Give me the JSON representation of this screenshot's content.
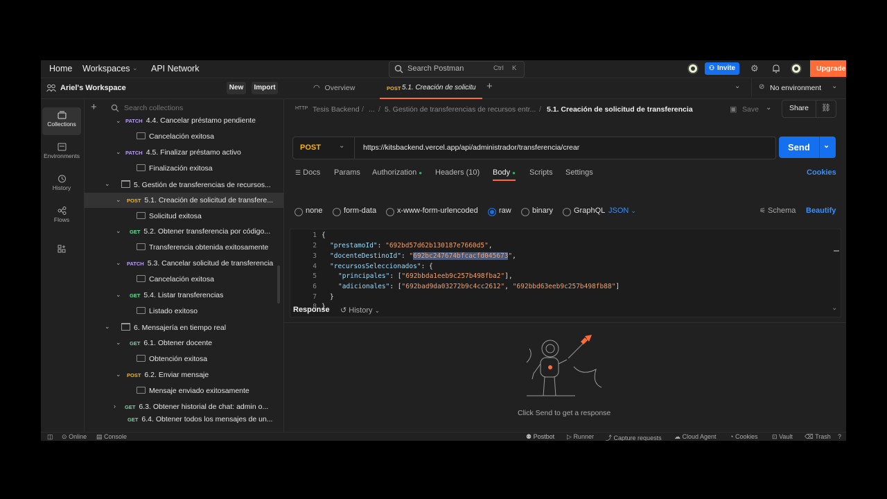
{
  "topbar": {
    "home": "Home",
    "workspaces": "Workspaces",
    "api_network": "API Network",
    "search_placeholder": "Search Postman",
    "shortcut_ctrl": "Ctrl",
    "shortcut_k": "K",
    "invite": "Invite",
    "upgrade": "Upgrade"
  },
  "workspace": {
    "name": "Ariel's Workspace",
    "new": "New",
    "import": "Import",
    "search_placeholder": "Search collections"
  },
  "rail": {
    "collections": "Collections",
    "environments": "Environments",
    "history": "History",
    "flows": "Flows"
  },
  "tree": [
    {
      "method": "PATCH",
      "label": "4.4. Cancelar préstamo pendiente"
    },
    {
      "label": "Cancelación exitosa"
    },
    {
      "method": "PATCH",
      "label": "4.5. Finalizar préstamo activo"
    },
    {
      "label": "Finalización exitosa"
    },
    {
      "label": "5. Gestión de transferencias de recursos..."
    },
    {
      "method": "POST",
      "label": "5.1. Creación de solicitud de transfere..."
    },
    {
      "label": "Solicitud exitosa"
    },
    {
      "method": "GET",
      "label": "5.2. Obtener transferencia por código..."
    },
    {
      "label": "Transferencia obtenida exitosamente"
    },
    {
      "method": "PATCH",
      "label": "5.3. Cancelar solicitud de transferencia"
    },
    {
      "label": "Cancelación exitosa"
    },
    {
      "method": "GET",
      "label": "5.4. Listar transferencias"
    },
    {
      "label": "Listado exitoso"
    },
    {
      "label": "6. Mensajería en tiempo real"
    },
    {
      "method": "GET",
      "label": "6.1. Obtener docente"
    },
    {
      "label": "Obtención exitosa"
    },
    {
      "method": "POST",
      "label": "6.2. Enviar mensaje"
    },
    {
      "label": "Mensaje enviado exitosamente"
    },
    {
      "method": "GET",
      "label": "6.3. Obtener historial de chat: admin o..."
    },
    {
      "method": "GET",
      "label": "6.4. Obtener todos los mensajes de un..."
    }
  ],
  "tabs": {
    "overview": "Overview",
    "active_method": "POST",
    "active_label": "5.1. Creación de solicitu",
    "environment": "No environment"
  },
  "breadcrumb": {
    "root": "Tesis Backend",
    "ellipsis": "...",
    "folder": "5. Gestión de transferencias de recursos entr...",
    "current": "5.1. Creación de solicitud de transferencia",
    "save": "Save",
    "share": "Share"
  },
  "request": {
    "method": "POST",
    "url": "https://kitsbackend.vercel.app/api/administrador/transferencia/crear",
    "send": "Send"
  },
  "subtabs": {
    "docs": "Docs",
    "params": "Params",
    "authorization": "Authorization",
    "headers": "Headers (10)",
    "body": "Body",
    "scripts": "Scripts",
    "settings": "Settings",
    "cookies": "Cookies"
  },
  "body_types": {
    "none": "none",
    "form_data": "form-data",
    "urlencoded": "x-www-form-urlencoded",
    "raw": "raw",
    "binary": "binary",
    "graphql": "GraphQL",
    "json": "JSON",
    "schema": "Schema",
    "beautify": "Beautify"
  },
  "editor": {
    "line_numbers": [
      "1",
      "2",
      "3",
      "4",
      "5",
      "6",
      "7",
      "8"
    ],
    "prestamo_key": "\"prestamoId\"",
    "prestamo_val": "\"692bd57d62b130187e7660d5\"",
    "docente_key": "\"docenteDestinoId\"",
    "docente_val": "692bc247674bfcacfd045673",
    "recursos_key": "\"recursosSeleccionados\"",
    "principales_key": "\"principales\"",
    "principales_val": "\"692bbda1eeb9c257b498fba2\"",
    "adicionales_key": "\"adicionales\"",
    "adicionales_val1": "\"692bad9da03272b9c4cc2612\"",
    "adicionales_val2": "\"692bbd63eeb9c257b498fb88\""
  },
  "response": {
    "title": "Response",
    "history": "History",
    "empty_text": "Click Send to get a response"
  },
  "statusbar": {
    "online": "Online",
    "console": "Console",
    "postbot": "Postbot",
    "runner": "Runner",
    "capture": "Capture requests",
    "cloud_agent": "Cloud Agent",
    "cookies": "Cookies",
    "vault": "Vault",
    "trash": "Trash"
  },
  "colors": {
    "accent": "#1470ef",
    "upgrade": "#ff6c37",
    "post": "#ffb400",
    "get": "#6bdd9a",
    "patch": "#b99ef5"
  }
}
